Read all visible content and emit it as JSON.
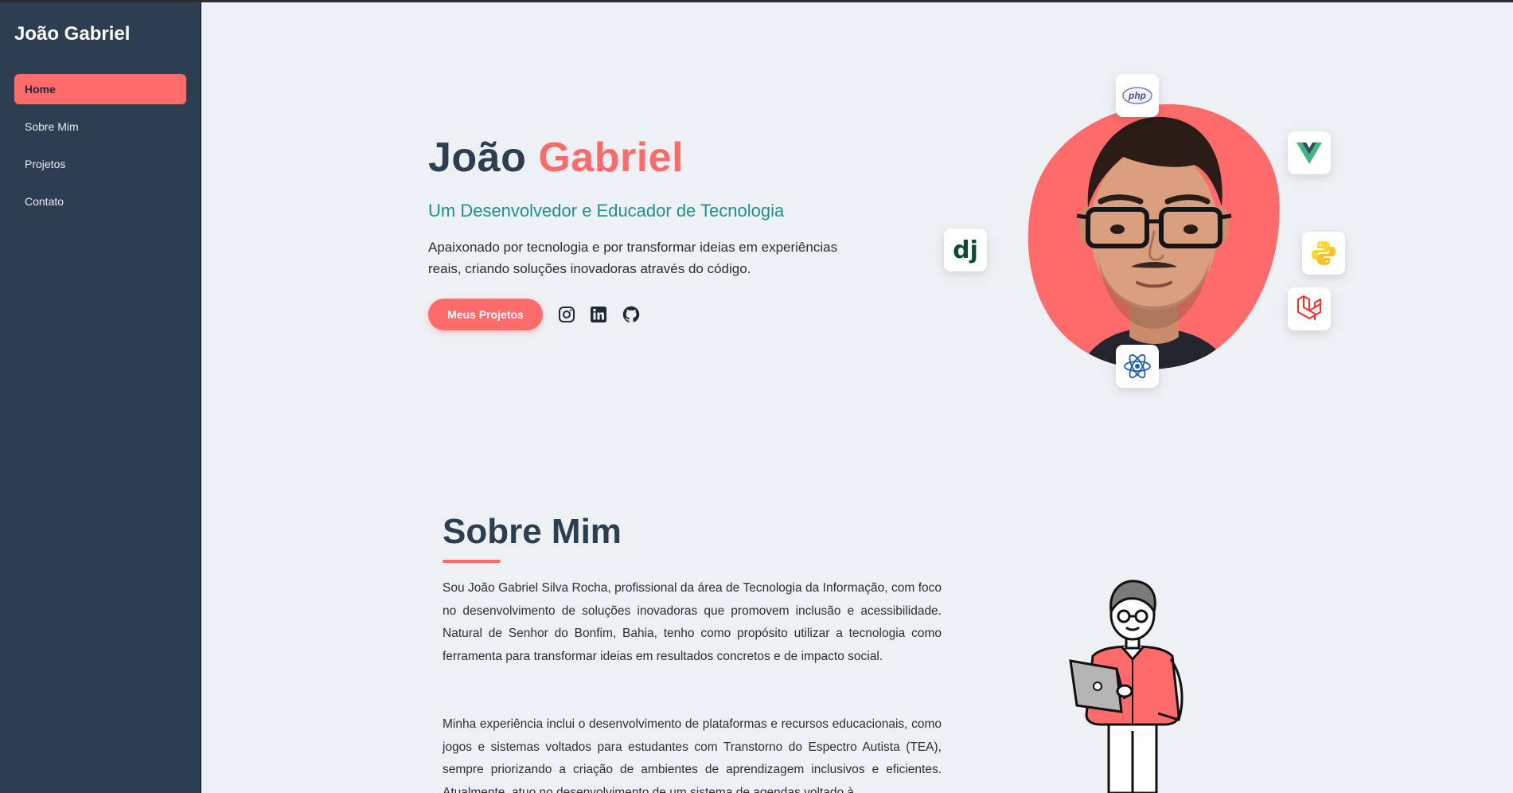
{
  "sidebar": {
    "brand": "João Gabriel",
    "items": [
      {
        "label": "Home",
        "active": true
      },
      {
        "label": "Sobre Mim",
        "active": false
      },
      {
        "label": "Projetos",
        "active": false
      },
      {
        "label": "Contato",
        "active": false
      }
    ]
  },
  "hero": {
    "first_name": "João",
    "last_name": "Gabriel",
    "subtitle": "Um Desenvolvedor e Educador de Tecnologia",
    "description": "Apaixonado por tecnologia e por transformar ideias em experiências reais, criando soluções inovadoras através do código.",
    "cta_label": "Meus Projetos",
    "social": [
      "instagram-icon",
      "linkedin-icon",
      "github-icon"
    ],
    "tech_icons": [
      "php-icon",
      "vue-icon",
      "django-icon",
      "python-icon",
      "laravel-icon",
      "react-icon"
    ]
  },
  "about": {
    "title": "Sobre Mim",
    "paragraph_1": "Sou João Gabriel Silva Rocha, profissional da área de Tecnologia da Informação, com foco no desenvolvimento de soluções inovadoras que promovem inclusão e acessibilidade. Natural de Senhor do Bonfim, Bahia, tenho como propósito utilizar a tecnologia como ferramenta para transformar ideias em resultados concretos e de impacto social.",
    "paragraph_2": "Minha experiência inclui o desenvolvimento de plataformas e recursos educacionais, como jogos e sistemas voltados para estudantes com Transtorno do Espectro Autista (TEA), sempre priorizando a criação de ambientes de aprendizagem inclusivos e eficientes. Atualmente, atuo no desenvolvimento de um sistema de agendas voltado à"
  },
  "colors": {
    "sidebar_bg": "#2c3e50",
    "accent": "#ff6b6b",
    "teal": "#20908f",
    "page_bg": "#eef1f4"
  }
}
